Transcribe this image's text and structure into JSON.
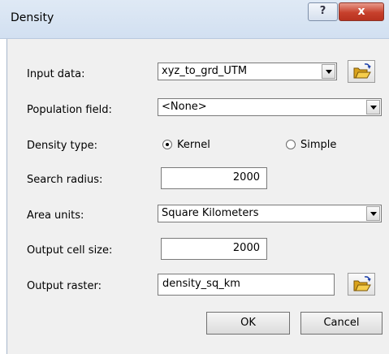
{
  "window": {
    "title": "Density",
    "help_label": "?",
    "close_label": "x"
  },
  "form": {
    "input_data": {
      "label": "Input data:",
      "value": "xyz_to_grd_UTM"
    },
    "population_field": {
      "label": "Population field:",
      "value": "<None>"
    },
    "density_type": {
      "label": "Density type:",
      "options": [
        "Kernel",
        "Simple"
      ],
      "selected": "Kernel"
    },
    "search_radius": {
      "label": "Search radius:",
      "value": "2000"
    },
    "area_units": {
      "label": "Area units:",
      "value": "Square Kilometers"
    },
    "output_cell_size": {
      "label": "Output cell size:",
      "value": "2000"
    },
    "output_raster": {
      "label": "Output raster:",
      "value": "density_sq_km"
    }
  },
  "buttons": {
    "ok": "OK",
    "cancel": "Cancel"
  },
  "icons": {
    "folder": "open-folder-icon",
    "dropdown": "chevron-down-icon",
    "help": "help-icon",
    "close": "close-icon"
  }
}
